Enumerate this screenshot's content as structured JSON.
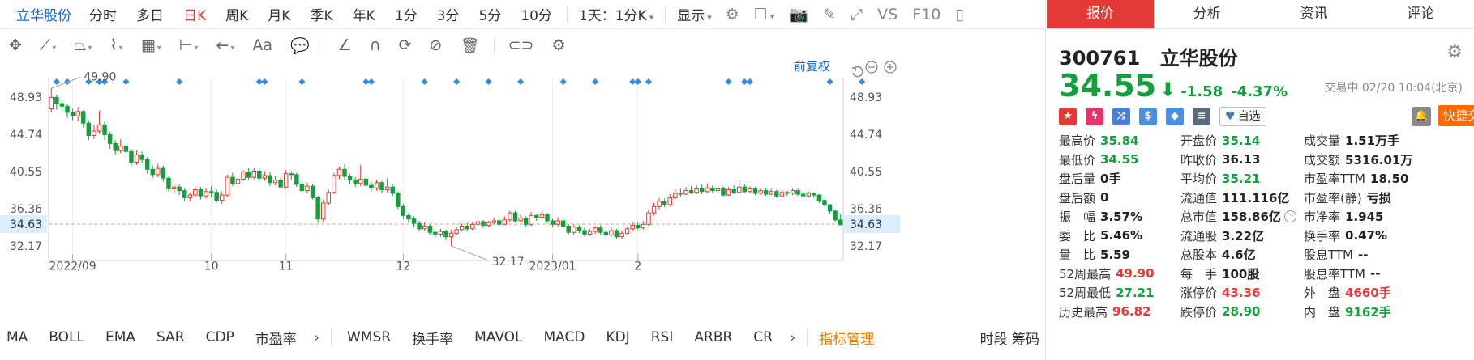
{
  "toolbar": {
    "stock_name": "立华股份",
    "periods": [
      "分时",
      "多日",
      "日K",
      "周K",
      "月K",
      "季K",
      "年K",
      "1分",
      "3分",
      "5分",
      "10分"
    ],
    "active_period": "日K",
    "range_select": "1天：1分K",
    "display_label": "显示",
    "vs_label": "VS",
    "f10_label": "F10"
  },
  "draw_tools": {
    "text_tool": "Aa"
  },
  "chart_labels": {
    "fuquan": "前复权",
    "high_mark": "49.90",
    "low_mark": "32.17",
    "last_price_tag": "34.63"
  },
  "chart_data": {
    "type": "candlestick",
    "y_ticks": [
      "48.93",
      "44.74",
      "40.55",
      "36.36",
      "32.17"
    ],
    "y_tick_values": [
      48.93,
      44.74,
      40.55,
      36.36,
      32.17
    ],
    "x_ticks": [
      "2022/09",
      "10",
      "11",
      "12",
      "2023/01",
      "2"
    ],
    "x_tick_index": [
      4,
      30,
      44,
      66,
      94,
      110
    ],
    "last_price": 34.63,
    "period_high": 49.9,
    "period_low": 32.17,
    "marker_index": [
      1,
      3,
      7,
      9,
      10,
      14,
      24,
      39,
      40,
      47,
      59,
      60,
      70,
      76,
      82,
      88,
      96,
      102,
      109,
      110,
      112,
      127,
      130,
      131,
      146,
      152,
      175,
      177,
      184
    ],
    "candles": [
      [
        47.6,
        48.9,
        49.9,
        47.2
      ],
      [
        48.9,
        48.2,
        49.2,
        47.5
      ],
      [
        48.2,
        47.9,
        48.6,
        47.3
      ],
      [
        47.9,
        47.2,
        48.1,
        46.6
      ],
      [
        47.2,
        46.8,
        47.6,
        46.3
      ],
      [
        46.8,
        47.3,
        47.8,
        46.2
      ],
      [
        47.3,
        46.0,
        47.5,
        45.5
      ],
      [
        46.0,
        44.6,
        46.3,
        44.1
      ],
      [
        44.6,
        45.1,
        45.8,
        44.2
      ],
      [
        45.1,
        45.8,
        47.4,
        44.8
      ],
      [
        45.8,
        44.7,
        46.2,
        44.1
      ],
      [
        44.7,
        43.7,
        45.0,
        43.1
      ],
      [
        43.7,
        42.9,
        44.1,
        42.4
      ],
      [
        42.9,
        43.4,
        44.2,
        42.6
      ],
      [
        43.4,
        42.8,
        43.9,
        42.2
      ],
      [
        42.8,
        41.6,
        43.1,
        41.2
      ],
      [
        41.6,
        42.4,
        42.9,
        41.3
      ],
      [
        42.4,
        41.9,
        42.8,
        41.5
      ],
      [
        41.9,
        40.8,
        42.2,
        40.3
      ],
      [
        40.8,
        40.2,
        41.2,
        39.8
      ],
      [
        40.2,
        40.9,
        41.4,
        39.9
      ],
      [
        40.9,
        39.8,
        41.2,
        39.4
      ],
      [
        39.8,
        38.6,
        40.1,
        38.3
      ],
      [
        38.6,
        38.8,
        39.2,
        38.1
      ],
      [
        38.8,
        38.4,
        39.1,
        37.9
      ],
      [
        38.4,
        37.6,
        38.7,
        37.2
      ],
      [
        37.6,
        37.9,
        38.2,
        37.2
      ],
      [
        37.9,
        38.5,
        38.9,
        37.7
      ],
      [
        38.5,
        37.8,
        38.8,
        37.4
      ],
      [
        37.8,
        38.3,
        38.7,
        37.5
      ],
      [
        38.3,
        38.2,
        38.9,
        37.6
      ],
      [
        38.2,
        37.3,
        38.5,
        37.1
      ],
      [
        37.3,
        37.9,
        38.3,
        36.9
      ],
      [
        37.9,
        39.9,
        40.2,
        37.7
      ],
      [
        39.9,
        39.2,
        40.4,
        38.9
      ],
      [
        39.2,
        39.7,
        40.1,
        38.8
      ],
      [
        39.7,
        40.5,
        40.7,
        39.5
      ],
      [
        40.5,
        39.9,
        40.9,
        39.6
      ],
      [
        39.9,
        40.6,
        40.9,
        39.7
      ],
      [
        40.6,
        39.8,
        40.9,
        39.4
      ],
      [
        39.8,
        40.1,
        40.6,
        39.5
      ],
      [
        40.1,
        39.3,
        40.5,
        38.9
      ],
      [
        39.3,
        39.6,
        40.0,
        39.0
      ],
      [
        39.6,
        38.8,
        39.9,
        38.6
      ],
      [
        38.8,
        40.3,
        40.7,
        38.6
      ],
      [
        40.3,
        40.2,
        40.6,
        39.6
      ],
      [
        40.2,
        39.1,
        40.4,
        38.8
      ],
      [
        39.1,
        38.4,
        39.4,
        38.2
      ],
      [
        38.4,
        38.9,
        39.3,
        38.1
      ],
      [
        38.9,
        37.6,
        39.1,
        37.4
      ],
      [
        37.6,
        35.2,
        37.8,
        34.8
      ],
      [
        35.2,
        37.0,
        37.4,
        34.9
      ],
      [
        37.0,
        38.2,
        38.5,
        36.8
      ],
      [
        38.2,
        40.1,
        40.4,
        38.0
      ],
      [
        40.1,
        40.8,
        41.1,
        39.7
      ],
      [
        40.8,
        40.0,
        41.4,
        39.6
      ],
      [
        40.0,
        39.6,
        40.3,
        39.1
      ],
      [
        39.6,
        39.2,
        39.9,
        38.8
      ],
      [
        39.2,
        39.7,
        41.3,
        38.9
      ],
      [
        39.7,
        39.0,
        40.0,
        38.7
      ],
      [
        39.0,
        38.7,
        39.4,
        38.3
      ],
      [
        38.7,
        39.3,
        39.6,
        38.4
      ],
      [
        39.3,
        38.5,
        39.5,
        38.1
      ],
      [
        38.5,
        38.8,
        39.8,
        38.2
      ],
      [
        38.8,
        38.1,
        39.1,
        37.8
      ],
      [
        38.1,
        36.6,
        38.3,
        36.3
      ],
      [
        36.6,
        35.6,
        36.9,
        35.2
      ],
      [
        35.6,
        35.2,
        35.9,
        34.8
      ],
      [
        35.2,
        34.7,
        35.5,
        34.3
      ],
      [
        34.7,
        34.1,
        35.0,
        33.8
      ],
      [
        34.1,
        34.4,
        34.8,
        33.9
      ],
      [
        34.4,
        33.7,
        34.6,
        33.4
      ],
      [
        33.7,
        33.5,
        33.9,
        33.1
      ],
      [
        33.5,
        33.8,
        34.1,
        33.2
      ],
      [
        33.8,
        33.2,
        34.0,
        32.8
      ],
      [
        33.2,
        33.6,
        34.0,
        32.17
      ],
      [
        33.6,
        34.0,
        34.3,
        33.4
      ],
      [
        34.0,
        34.4,
        34.7,
        33.8
      ],
      [
        34.4,
        34.1,
        34.8,
        33.9
      ],
      [
        34.1,
        34.6,
        34.9,
        33.9
      ],
      [
        34.6,
        34.9,
        35.2,
        34.4
      ],
      [
        34.9,
        34.5,
        35.1,
        34.2
      ],
      [
        34.5,
        34.8,
        35.0,
        34.3
      ],
      [
        34.8,
        35.0,
        35.3,
        34.6
      ],
      [
        35.0,
        34.6,
        35.2,
        34.4
      ],
      [
        34.6,
        35.1,
        35.5,
        34.5
      ],
      [
        35.1,
        35.9,
        36.1,
        34.9
      ],
      [
        35.9,
        35.0,
        36.1,
        34.8
      ],
      [
        35.0,
        35.3,
        35.7,
        34.8
      ],
      [
        35.3,
        34.6,
        35.5,
        34.3
      ],
      [
        34.6,
        35.6,
        36.0,
        34.4
      ],
      [
        35.6,
        35.4,
        35.8,
        35.0
      ],
      [
        35.4,
        35.7,
        36.1,
        35.2
      ],
      [
        35.7,
        35.0,
        35.9,
        34.7
      ],
      [
        35.0,
        34.6,
        35.2,
        34.3
      ],
      [
        34.6,
        35.0,
        35.4,
        34.4
      ],
      [
        35.0,
        34.4,
        35.3,
        34.1
      ],
      [
        34.4,
        33.7,
        34.6,
        33.5
      ],
      [
        33.7,
        34.3,
        34.6,
        33.4
      ],
      [
        34.3,
        33.9,
        34.5,
        33.6
      ],
      [
        33.9,
        33.5,
        34.3,
        33.2
      ],
      [
        33.5,
        33.8,
        34.1,
        33.3
      ],
      [
        33.8,
        34.2,
        34.4,
        33.5
      ],
      [
        34.2,
        33.7,
        34.5,
        33.4
      ],
      [
        33.7,
        33.4,
        34.0,
        33.1
      ],
      [
        33.4,
        33.9,
        34.3,
        33.2
      ],
      [
        33.9,
        33.2,
        34.1,
        33.0
      ],
      [
        33.2,
        33.6,
        33.9,
        32.9
      ],
      [
        33.6,
        34.1,
        34.4,
        33.4
      ],
      [
        34.1,
        34.5,
        34.8,
        33.8
      ],
      [
        34.5,
        34.2,
        34.9,
        34.0
      ],
      [
        34.2,
        34.6,
        35.0,
        34.0
      ],
      [
        34.6,
        35.9,
        36.3,
        34.4
      ],
      [
        35.9,
        36.6,
        37.0,
        35.6
      ],
      [
        36.6,
        37.2,
        37.6,
        36.3
      ],
      [
        37.2,
        36.8,
        37.5,
        36.5
      ],
      [
        36.8,
        37.6,
        38.0,
        36.6
      ],
      [
        37.6,
        38.1,
        38.5,
        37.4
      ],
      [
        38.1,
        38.0,
        38.6,
        37.7
      ],
      [
        38.0,
        38.4,
        38.8,
        37.9
      ],
      [
        38.4,
        38.2,
        38.9,
        38.0
      ],
      [
        38.2,
        38.6,
        39.0,
        38.0
      ],
      [
        38.6,
        38.3,
        39.1,
        38.0
      ],
      [
        38.3,
        38.7,
        39.2,
        38.1
      ],
      [
        38.7,
        38.4,
        39.0,
        38.1
      ],
      [
        38.4,
        38.6,
        39.3,
        38.2
      ],
      [
        38.6,
        37.9,
        38.9,
        37.7
      ],
      [
        37.9,
        38.5,
        38.8,
        37.8
      ],
      [
        38.5,
        38.2,
        39.0,
        38.0
      ],
      [
        38.2,
        38.8,
        39.6,
        38.1
      ],
      [
        38.8,
        38.3,
        39.1,
        38.1
      ],
      [
        38.3,
        38.6,
        38.9,
        38.1
      ],
      [
        38.6,
        38.1,
        38.8,
        37.9
      ],
      [
        38.1,
        38.4,
        38.7,
        37.9
      ],
      [
        38.4,
        38.0,
        38.7,
        37.8
      ],
      [
        38.0,
        38.3,
        38.6,
        37.9
      ],
      [
        38.3,
        37.8,
        38.5,
        37.6
      ],
      [
        37.8,
        38.2,
        38.5,
        37.6
      ],
      [
        38.2,
        38.1,
        38.4,
        37.8
      ],
      [
        38.1,
        38.4,
        38.6,
        37.9
      ],
      [
        38.4,
        38.0,
        38.6,
        37.8
      ],
      [
        38.0,
        37.8,
        38.3,
        37.5
      ],
      [
        37.8,
        38.1,
        38.3,
        37.6
      ],
      [
        38.1,
        37.9,
        38.2,
        37.6
      ],
      [
        37.9,
        37.3,
        38.0,
        37.0
      ],
      [
        37.3,
        36.8,
        37.4,
        36.6
      ],
      [
        36.8,
        36.1,
        36.9,
        35.8
      ],
      [
        36.1,
        35.1,
        36.2,
        34.9
      ],
      [
        35.1,
        34.55,
        35.84,
        34.55
      ]
    ]
  },
  "indicators": {
    "items": [
      "MA",
      "BOLL",
      "EMA",
      "SAR",
      "CDP",
      "市盈率",
      "WMSR",
      "换手率",
      "MAVOL",
      "MACD",
      "KDJ",
      "RSI",
      "ARBR",
      "CR"
    ],
    "manage_label": "指标管理",
    "right_label": "时段 筹码"
  },
  "quote": {
    "tabs": [
      "报价",
      "分析",
      "资讯",
      "评论"
    ],
    "code": "300761",
    "name": "立华股份",
    "price": "34.55",
    "change": "-1.58",
    "change_pct": "-4.37%",
    "trade_status": "交易中 02/20 10:04(北京)",
    "watch_label": "自选",
    "fast_trade_label": "快捷交易",
    "badge_colors": [
      "#e53935",
      "#e5356b",
      "#4a7de0",
      "#4a90e2",
      "#4a90e2",
      "#5a6b80"
    ],
    "up_color": "#e53935",
    "down_color": "#13a03c",
    "stats": [
      [
        {
          "label": "最高价",
          "value": "35.84",
          "tone": "green"
        },
        {
          "label": "开盘价",
          "value": "35.14",
          "tone": "green"
        },
        {
          "label": "成交量",
          "value": "1.51万手",
          "tone": ""
        }
      ],
      [
        {
          "label": "最低价",
          "value": "34.55",
          "tone": "green"
        },
        {
          "label": "昨收价",
          "value": "36.13",
          "tone": ""
        },
        {
          "label": "成交额",
          "value": "5316.01万",
          "tone": ""
        }
      ],
      [
        {
          "label": "盘后量",
          "value": "0手",
          "tone": ""
        },
        {
          "label": "平均价",
          "value": "35.21",
          "tone": "green"
        },
        {
          "label": "市盈率TTM",
          "value": "18.50",
          "tone": ""
        }
      ],
      [
        {
          "label": "盘后额",
          "value": "0",
          "tone": ""
        },
        {
          "label": "流通值",
          "value": "111.116亿",
          "tone": ""
        },
        {
          "label": "市盈率(静)",
          "value": "亏损",
          "tone": ""
        }
      ],
      [
        {
          "label": "振　幅",
          "value": "3.57%",
          "tone": ""
        },
        {
          "label": "总市值",
          "value": "158.86亿",
          "tone": ""
        },
        {
          "label": "市净率",
          "value": "1.945",
          "tone": ""
        }
      ],
      [
        {
          "label": "委　比",
          "value": "5.46%",
          "tone": ""
        },
        {
          "label": "流通股",
          "value": "3.22亿",
          "tone": ""
        },
        {
          "label": "换手率",
          "value": "0.47%",
          "tone": ""
        }
      ],
      [
        {
          "label": "量　比",
          "value": "5.59",
          "tone": ""
        },
        {
          "label": "总股本",
          "value": "4.6亿",
          "tone": ""
        },
        {
          "label": "股息TTM",
          "value": "--",
          "tone": ""
        }
      ],
      [
        {
          "label": "52周最高",
          "value": "49.90",
          "tone": "red"
        },
        {
          "label": "每　手",
          "value": "100股",
          "tone": ""
        },
        {
          "label": "股息率TTM",
          "value": "--",
          "tone": ""
        }
      ],
      [
        {
          "label": "52周最低",
          "value": "27.21",
          "tone": "green"
        },
        {
          "label": "涨停价",
          "value": "43.36",
          "tone": "red"
        },
        {
          "label": "外　盘",
          "value": "4660手",
          "tone": "red"
        }
      ],
      [
        {
          "label": "历史最高",
          "value": "96.82",
          "tone": "red"
        },
        {
          "label": "跌停价",
          "value": "28.90",
          "tone": "green"
        },
        {
          "label": "内　盘",
          "value": "9162手",
          "tone": "green"
        }
      ]
    ]
  }
}
